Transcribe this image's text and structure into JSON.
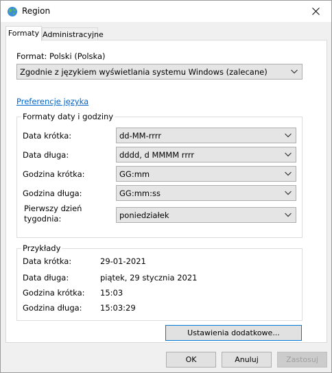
{
  "window": {
    "title": "Region"
  },
  "tabs": [
    {
      "label": "Formaty"
    },
    {
      "label": "Administracyjne"
    }
  ],
  "format": {
    "label": "Format: Polski (Polska)",
    "value": "Zgodnie z językiem wyświetlania systemu Windows (zalecane)"
  },
  "preferences_link": "Preferencje języka",
  "date_time_group": {
    "title": "Formaty daty i godziny",
    "rows": [
      {
        "label": "Data krótka:",
        "value": "dd-MM-rrrr"
      },
      {
        "label": "Data długa:",
        "value": "dddd, d MMMM rrrr"
      },
      {
        "label": "Godzina krótka:",
        "value": "GG:mm"
      },
      {
        "label": "Godzina długa:",
        "value": "GG:mm:ss"
      },
      {
        "label": "Pierwszy dzień\ntygodnia:",
        "value": "poniedziałek"
      }
    ]
  },
  "examples_group": {
    "title": "Przykłady",
    "rows": [
      {
        "label": "Data krótka:",
        "value": "29-01-2021"
      },
      {
        "label": "Data długa:",
        "value": "piątek, 29 stycznia 2021"
      },
      {
        "label": "Godzina krótka:",
        "value": "15:03"
      },
      {
        "label": "Godzina długa:",
        "value": "15:03:29"
      }
    ]
  },
  "buttons": {
    "additional": "Ustawienia dodatkowe...",
    "ok": "OK",
    "cancel": "Anuluj",
    "apply": "Zastosuj"
  },
  "colors": {
    "link": "#0066cc",
    "accent": "#0078d7"
  },
  "icons": {
    "title": "globe-icon",
    "close": "close-icon",
    "dropdown": "chevron-down-icon"
  }
}
